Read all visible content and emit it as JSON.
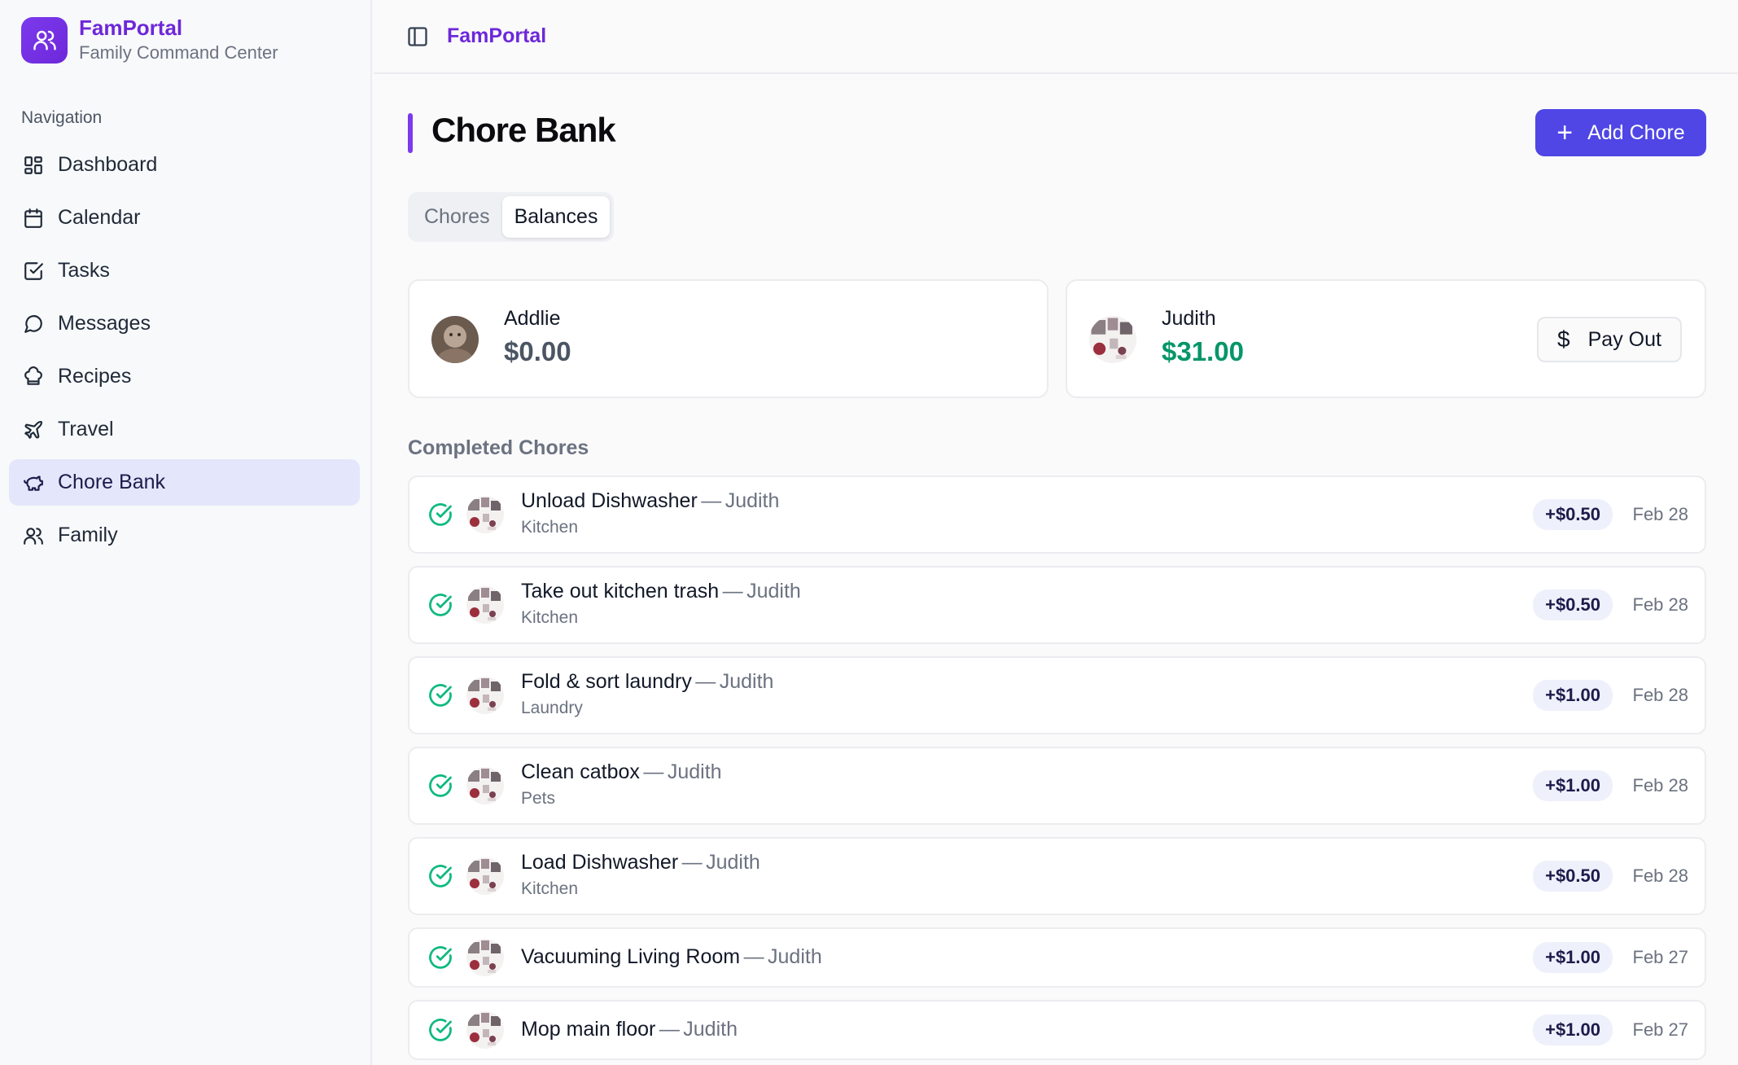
{
  "brand": {
    "name": "FamPortal",
    "subtitle": "Family Command Center",
    "icon": "users-icon"
  },
  "sidebar": {
    "heading": "Navigation",
    "items": [
      {
        "label": "Dashboard",
        "icon": "dashboard-icon"
      },
      {
        "label": "Calendar",
        "icon": "calendar-icon"
      },
      {
        "label": "Tasks",
        "icon": "check-square-icon"
      },
      {
        "label": "Messages",
        "icon": "message-icon"
      },
      {
        "label": "Recipes",
        "icon": "chef-hat-icon"
      },
      {
        "label": "Travel",
        "icon": "plane-icon"
      },
      {
        "label": "Chore Bank",
        "icon": "piggy-bank-icon",
        "active": true
      },
      {
        "label": "Family",
        "icon": "users-icon"
      }
    ]
  },
  "topbar": {
    "title": "FamPortal",
    "toggle_icon": "sidebar-toggle-icon"
  },
  "page": {
    "title": "Chore Bank",
    "add_button": "Add Chore",
    "tabs": [
      {
        "label": "Chores",
        "active": false
      },
      {
        "label": "Balances",
        "active": true
      }
    ]
  },
  "balances": [
    {
      "name": "Addlie",
      "amount": "$0.00"
    },
    {
      "name": "Judith",
      "amount": "$31.00",
      "action": "Pay Out"
    }
  ],
  "completed": {
    "title": "Completed Chores",
    "separator": "—",
    "rows": [
      {
        "chore": "Unload Dishwasher",
        "person": "Judith",
        "category": "Kitchen",
        "amount": "+$0.50",
        "date": "Feb 28"
      },
      {
        "chore": "Take out kitchen trash",
        "person": "Judith",
        "category": "Kitchen",
        "amount": "+$0.50",
        "date": "Feb 28"
      },
      {
        "chore": "Fold & sort laundry",
        "person": "Judith",
        "category": "Laundry",
        "amount": "+$1.00",
        "date": "Feb 28"
      },
      {
        "chore": "Clean catbox",
        "person": "Judith",
        "category": "Pets",
        "amount": "+$1.00",
        "date": "Feb 28"
      },
      {
        "chore": "Load Dishwasher",
        "person": "Judith",
        "category": "Kitchen",
        "amount": "+$0.50",
        "date": "Feb 28"
      },
      {
        "chore": "Vacuuming Living Room",
        "person": "Judith",
        "category": "",
        "amount": "+$1.00",
        "date": "Feb 27"
      },
      {
        "chore": "Mop main floor",
        "person": "Judith",
        "category": "",
        "amount": "+$1.00",
        "date": "Feb 27"
      }
    ]
  },
  "colors": {
    "accent": "#7c3aed",
    "primary_button": "#4f46e5",
    "positive": "#059669",
    "active_nav": "#e4e7fb"
  }
}
